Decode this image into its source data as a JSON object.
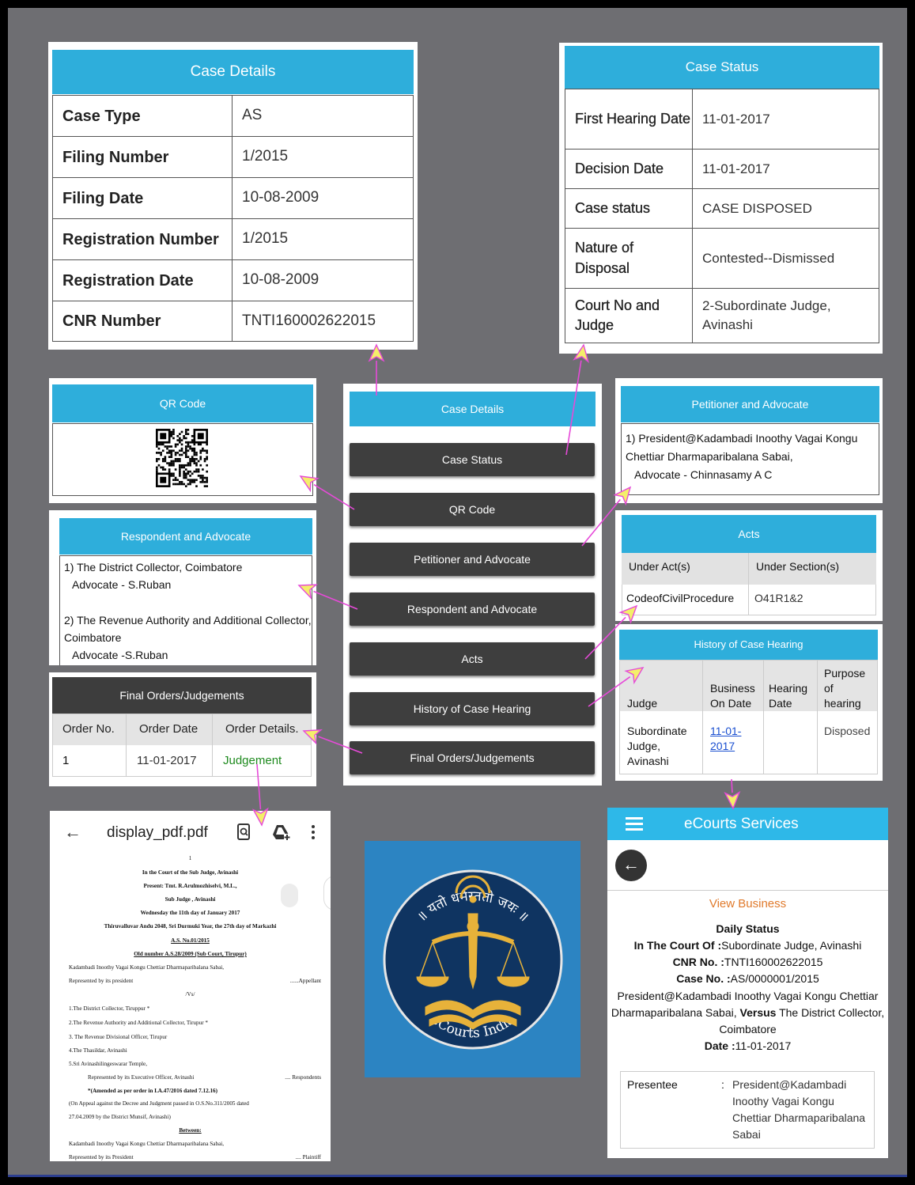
{
  "case_details": {
    "title": "Case Details",
    "rows": [
      {
        "k": "Case Type",
        "v": "AS"
      },
      {
        "k": "Filing Number",
        "v": "1/2015"
      },
      {
        "k": "Filing Date",
        "v": "10-08-2009"
      },
      {
        "k": "Registration Number",
        "v": "1/2015"
      },
      {
        "k": "Registration Date",
        "v": "10-08-2009"
      },
      {
        "k": "CNR Number",
        "v": "TNTI160002622015"
      }
    ]
  },
  "case_status": {
    "title": "Case Status",
    "rows": [
      {
        "k": "First Hearing Date",
        "v": "11-01-2017"
      },
      {
        "k": "Decision Date",
        "v": "11-01-2017"
      },
      {
        "k": "Case status",
        "v": "CASE DISPOSED"
      },
      {
        "k": "Nature of Disposal",
        "v": "Contested--Dismissed"
      },
      {
        "k": "Court No and Judge",
        "v": "2-Subordinate Judge, Avinashi"
      }
    ]
  },
  "qr": {
    "title": "QR Code"
  },
  "menu": {
    "header": "Case Details",
    "items": [
      "Case Status",
      "QR Code",
      "Petitioner and Advocate",
      "Respondent and Advocate",
      "Acts",
      "History of Case Hearing",
      "Final Orders/Judgements"
    ]
  },
  "petitioner": {
    "title": "Petitioner and Advocate",
    "line1": "1) President@Kadambadi Inoothy Vagai Kongu",
    "line2": "Chettiar Dharmaparibalana Sabai,",
    "line3": "Advocate - Chinnasamy A C"
  },
  "respondent": {
    "title": "Respondent and Advocate",
    "r1": "1) The District Collector, Coimbatore",
    "r1adv": "Advocate - S.Ruban",
    "r2": "2) The Revenue Authority and Additional Collector,",
    "r2b": "Coimbatore",
    "r2adv": "Advocate -S.Ruban"
  },
  "acts": {
    "title": "Acts",
    "h1": "Under Act(s)",
    "h2": "Under Section(s)",
    "act": "CodeofCivilProcedure",
    "section": "O41R1&2"
  },
  "history": {
    "title": "History of Case Hearing",
    "h_judge": "Judge",
    "h_bus1": "Business",
    "h_bus2": "On Date",
    "h_hear1": "Hearing",
    "h_hear2": "Date",
    "h_p1": "Purpose",
    "h_p2": "of",
    "h_p3": "hearing",
    "judge1": "Subordinate",
    "judge2": "Judge,",
    "judge3": "Avinashi",
    "bus1": "11-01-",
    "bus2": "2017",
    "purpose": "Disposed"
  },
  "final_orders": {
    "title": "Final Orders/Judgements",
    "h1": "Order No.",
    "h2": "Order Date",
    "h3": "Order Details.",
    "no": "1",
    "date": "11-01-2017",
    "details": "Judgement"
  },
  "pdf": {
    "filename": "display_pdf.pdf",
    "lines": [
      "1",
      "In the Court of the Sub Judge, Avinashi",
      "Present: Tmt. R.Arulmozhiselvi, M.L.,",
      "Sub Judge , Avinashi",
      "Wednesday the 11th day of January 2017",
      "Thiruvalluvar Andu 2048, Sri Durmuki Year, the 27th day of Markazhi",
      "A.S. No.01/2015",
      "Old number A.S.28/2009 (Sub Court, Tirupur)",
      "Kadambadi Inoothy Vagai Kongu Chettiar Dharmaparibalana Sabai,",
      "Represented by its president",
      "......Appellant",
      "/Vs/",
      "1.The District Collector, Tiruppur *",
      "2.The Revenue Authority and Additional Collector, Tirupur *",
      "3. The Revenue Divisional Officer, Tirupur",
      "4.The Thasildar, Avinashi",
      "5.Sri Avinashilingeswarar Temple,",
      "Represented by its Executive Officer, Avinashi",
      ".... Respondents",
      "*(Amended as per order in I.A.47/2016 dated 7.12.16)",
      "(On Appeal against the Decree and Judgment passed in O.S.No.311/2005 dated",
      "27.04.2009 by the District Munsif, Avinashi)",
      "Between:",
      "Kadambadi Inoothy Vagai Kongu Chettiar Dharmaparibalana Sabai,",
      "Represented by its President",
      ".... Plaintiff"
    ]
  },
  "logo": {
    "motto": "॥ यतो धर्मस्ततो जयः ॥",
    "name": "eCourts India"
  },
  "ecourts": {
    "title": "eCourts Services",
    "view": "View Business",
    "daily": "Daily Status",
    "court_k": "In The Court Of :",
    "court_v": "Subordinate Judge, Avinashi",
    "cnr_k": "CNR No. :",
    "cnr_v": "TNTI160002622015",
    "case_k": "Case No. :",
    "case_v": "AS/0000001/2015",
    "parties1a": "President@Kadambadi Inoothy Vagai Kongu Chettiar",
    "parties2a": "Dharmaparibalana Sabai, ",
    "versus": "Versus",
    "parties2b": " The District Collector,",
    "parties3": "Coimbatore",
    "date_k": "Date :",
    "date_v": "11-01-2017",
    "presentee_k": "Presentee",
    "colon": ":",
    "presentee_v1": "President@Kadambadi",
    "presentee_v2": "Inoothy Vagai Kongu",
    "presentee_v3": "Chettiar Dharmaparibalana",
    "presentee_v4": "Sabai"
  },
  "colors": {
    "header_blue": "#2eaedb",
    "dark": "#3d3d3d",
    "arrow": "#e64ad8",
    "arrow_fill": "#f4ef6a",
    "link": "#1a4fd0",
    "green": "#1e8a1e",
    "orange": "#e07a2c",
    "navy": "#0f3461",
    "gold": "#e7b23a"
  }
}
